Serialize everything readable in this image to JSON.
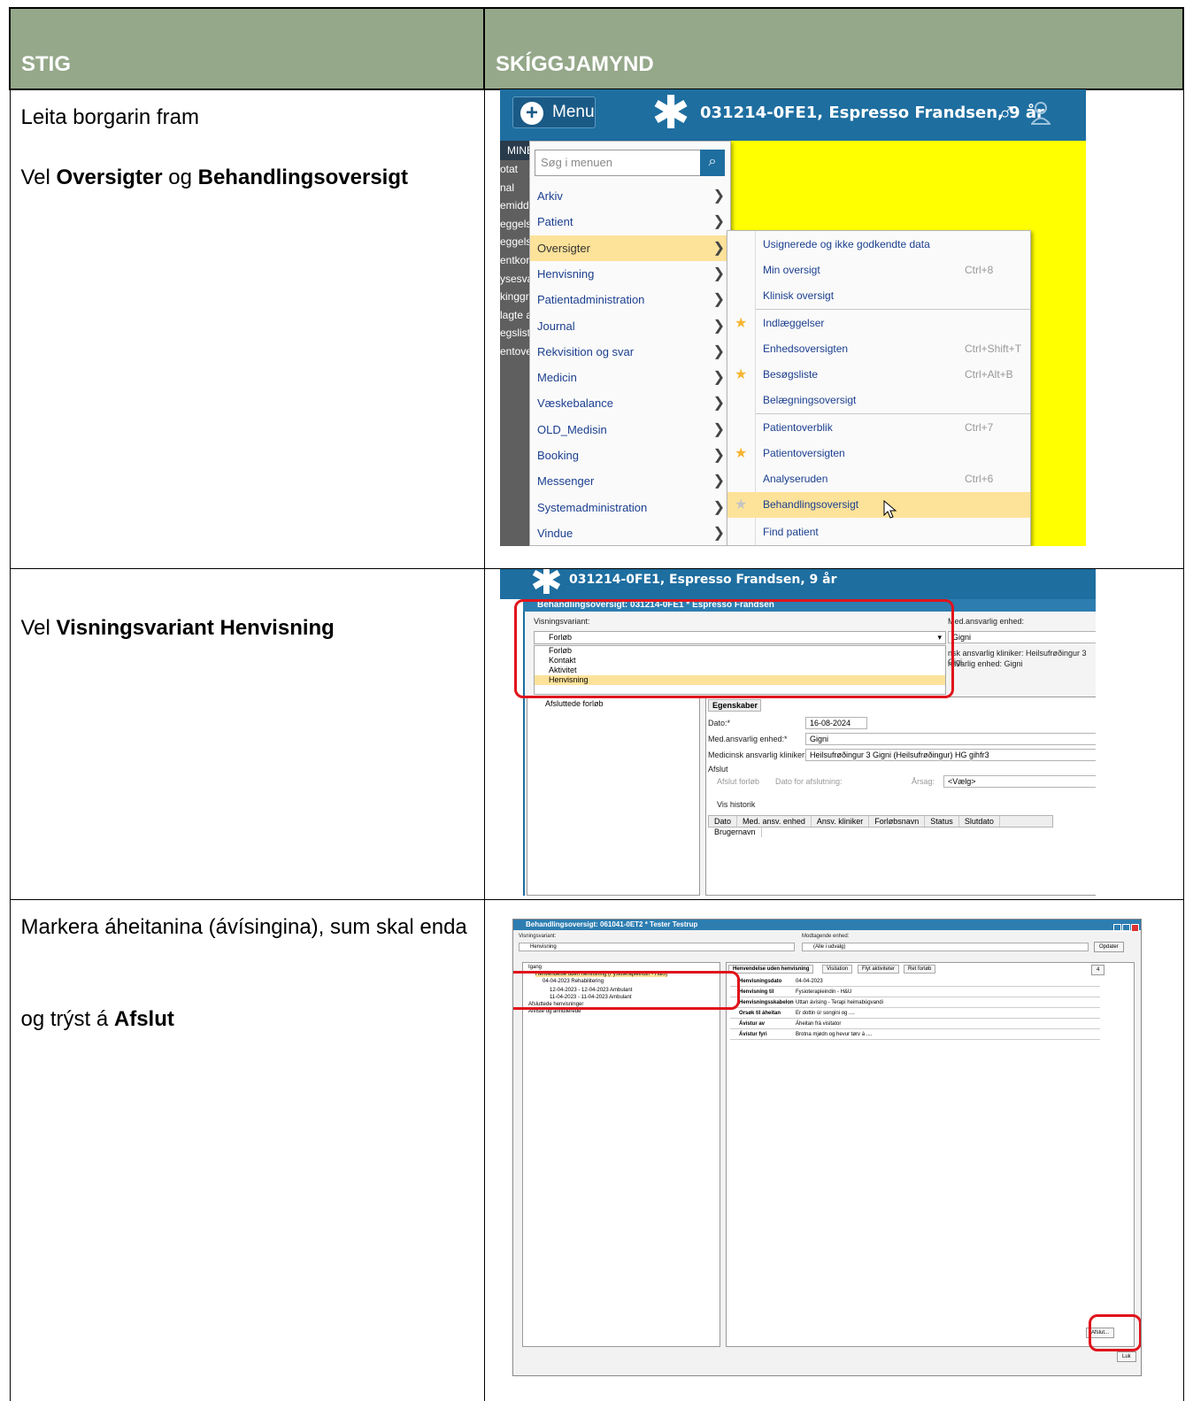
{
  "table": {
    "header_left": "STIG",
    "header_right": "SKÍGGJAMYND"
  },
  "steps": [
    {
      "line1": "Leita borgarin fram",
      "line2_prefix": "Vel ",
      "line2_bold1": "Oversigter",
      "line2_mid": " og ",
      "line2_bold2": "Behandlingsoversigt"
    },
    {
      "prefix": "Vel ",
      "bold": "Visningsvariant Henvisning"
    },
    {
      "line1": "Markera áheitanina (ávísingina), sum skal enda",
      "line2_prefix": "og trýst á ",
      "line2_bold": "Afslut"
    }
  ],
  "shot1": {
    "menu_label": "Menu",
    "patient_title": "031214-0FE1, Espresso Frandsen, 9 år",
    "left_head": "MINE",
    "left_items": [
      "otat",
      "nal",
      "emidde",
      "eggelse",
      "eggelse",
      "entkort",
      "ysesva",
      "kinggru",
      "lagte a",
      "egsliste",
      "entovers"
    ],
    "search_placeholder": "Søg i menuen",
    "main_menu": [
      "Arkiv",
      "Patient",
      "Oversigter",
      "Henvisning",
      "Patientadministration",
      "Journal",
      "Rekvisition og svar",
      "Medicin",
      "Væskebalance",
      "OLD_Medisin",
      "Booking",
      "Messenger",
      "Systemadministration",
      "Vindue"
    ],
    "submenu": [
      {
        "label": "Usignerede og ikke godkendte data",
        "shortcut": ""
      },
      {
        "label": "Min oversigt",
        "shortcut": "Ctrl+8"
      },
      {
        "label": "Klinisk oversigt",
        "shortcut": ""
      },
      {
        "label": "Indlæggelser",
        "shortcut": ""
      },
      {
        "label": "Enhedsoversigten",
        "shortcut": "Ctrl+Shift+T"
      },
      {
        "label": "Besøgsliste",
        "shortcut": "Ctrl+Alt+B"
      },
      {
        "label": "Belægningsoversigt",
        "shortcut": ""
      },
      {
        "label": "Patientoverblik",
        "shortcut": "Ctrl+7"
      },
      {
        "label": "Patientoversigten",
        "shortcut": ""
      },
      {
        "label": "Analyseruden",
        "shortcut": "Ctrl+6"
      },
      {
        "label": "Behandlingsoversigt",
        "shortcut": ""
      },
      {
        "label": "Find patient",
        "shortcut": ""
      }
    ]
  },
  "shot2": {
    "patient_title": "031214-0FE1, Espresso Frandsen, 9 år",
    "window_title": "Behandlingsoversigt: 031214-0FE1 * Espresso Frandsen",
    "visning_label": "Visningsvariant:",
    "visning_value": "Forløb",
    "ansvar_label": "Med.ansvarlig enhed:",
    "ansvar_value": "Gigni",
    "dropdown": [
      "Forløb",
      "Kontakt",
      "Aktivitet",
      "Henvisning"
    ],
    "right_line1": "nsk ansvarlig kliniker: Heilsufrøðingur 3 Gigi",
    "right_line2": "nsvarlig enhed: Gigni",
    "tree_date": "16-08-2024 - 16-08-2024",
    "tree_closed": "Afsluttede forløb",
    "tab": "Egenskaber",
    "dato_label": "Dato:*",
    "dato_value": "16-08-2024",
    "enhed_label": "Med.ansvarlig enhed:*",
    "enhed_value": "Gigni",
    "kliniker_label": "Medicinsk ansvarlig kliniker:",
    "kliniker_value": "Heilsufrøðingur 3 Gigni (Heilsufrøðingur) HG gihfr3",
    "afslut_group": "Afslut",
    "afslut_forlob": "Afslut forløb",
    "dato_afslut": "Dato for afslutning:",
    "aarsag": "Årsag:",
    "vaelg": "<Vælg>",
    "vis_historik": "Vis historik",
    "grid_cols": [
      "Dato",
      "Med. ansv. enhed",
      "Ansv. kliniker",
      "Forløbsnavn",
      "Status",
      "Slutdato",
      "Brugernavn"
    ]
  },
  "shot3": {
    "window_title": "Behandlingsoversigt: 061041-0ET2 * Tester Testrup",
    "visning_label": "Visningsvariant:",
    "visning_value": "Henvisning",
    "modt_label": "Modtagende enhed:",
    "modt_value": "(Alle i udvalg)",
    "opdater": "Opdater",
    "tree": [
      "Igang",
      "Henvendelse uden henvisning (Fysioterapieindin - H&U)",
      "04-04-2023  Rehabilitering",
      "12-04-2023  -  12-04-2023  Ambulant",
      "11-04-2023  -  11-04-2023  Ambulant",
      "Afsluttede henvisninger",
      "Afviste og annullerede"
    ],
    "tabs": [
      "Henvendelse uden henvisning",
      "Visitation",
      "Flyt aktiviteter",
      "Ret forløb"
    ],
    "count": "4",
    "fields": [
      {
        "k": "Henvisningsdato",
        "v": "04-04-2023"
      },
      {
        "k": "Henvisning til",
        "v": "Fysioterapieindin - H&U"
      },
      {
        "k": "Henvisningsskabelon",
        "v": "Uttan ávísing - Terapi heimabúgvandi"
      },
      {
        "k": "Orsøk til áheitan",
        "v": "Er dottin úr songini og ...."
      },
      {
        "k": "Ávístur av",
        "v": "Áheitan frá visitator"
      },
      {
        "k": "Ávístur fyri",
        "v": "Brotna mjødn og hevur tørv á ...."
      }
    ],
    "afslut_btn": "Afslut...",
    "luk_btn": "Luk"
  }
}
